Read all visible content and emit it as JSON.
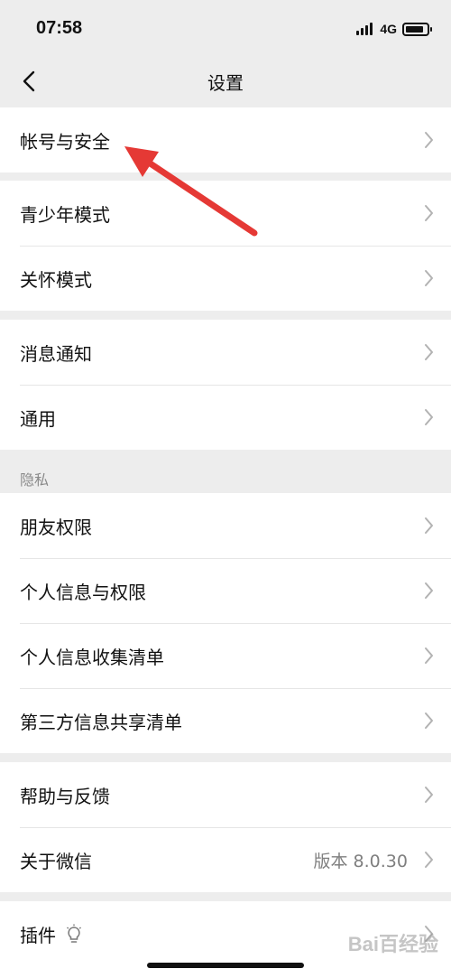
{
  "status_bar": {
    "time": "07:58",
    "network": "4G",
    "battery_level": 0.85
  },
  "nav": {
    "title": "设置",
    "back_icon": "chevron-left-icon"
  },
  "groups": {
    "account": {
      "item_0": "帐号与安全"
    },
    "modes": {
      "item_0": "青少年模式",
      "item_1": "关怀模式"
    },
    "general": {
      "item_0": "消息通知",
      "item_1": "通用"
    },
    "privacy": {
      "header": "隐私",
      "item_0": "朋友权限",
      "item_1": "个人信息与权限",
      "item_2": "个人信息收集清单",
      "item_3": "第三方信息共享清单"
    },
    "about": {
      "item_0": "帮助与反馈",
      "item_1": "关于微信",
      "version": "版本 8.0.30"
    },
    "plugins": {
      "item_0": "插件",
      "icon": "lightbulb-icon"
    }
  },
  "annotation": {
    "color": "#e53935",
    "points_to": "帐号与安全"
  },
  "watermark": "Bai百经验",
  "colors": {
    "background": "#ededed",
    "card": "#ffffff",
    "secondary_text": "#7f7f7f",
    "divider": "#e6e6e6"
  }
}
